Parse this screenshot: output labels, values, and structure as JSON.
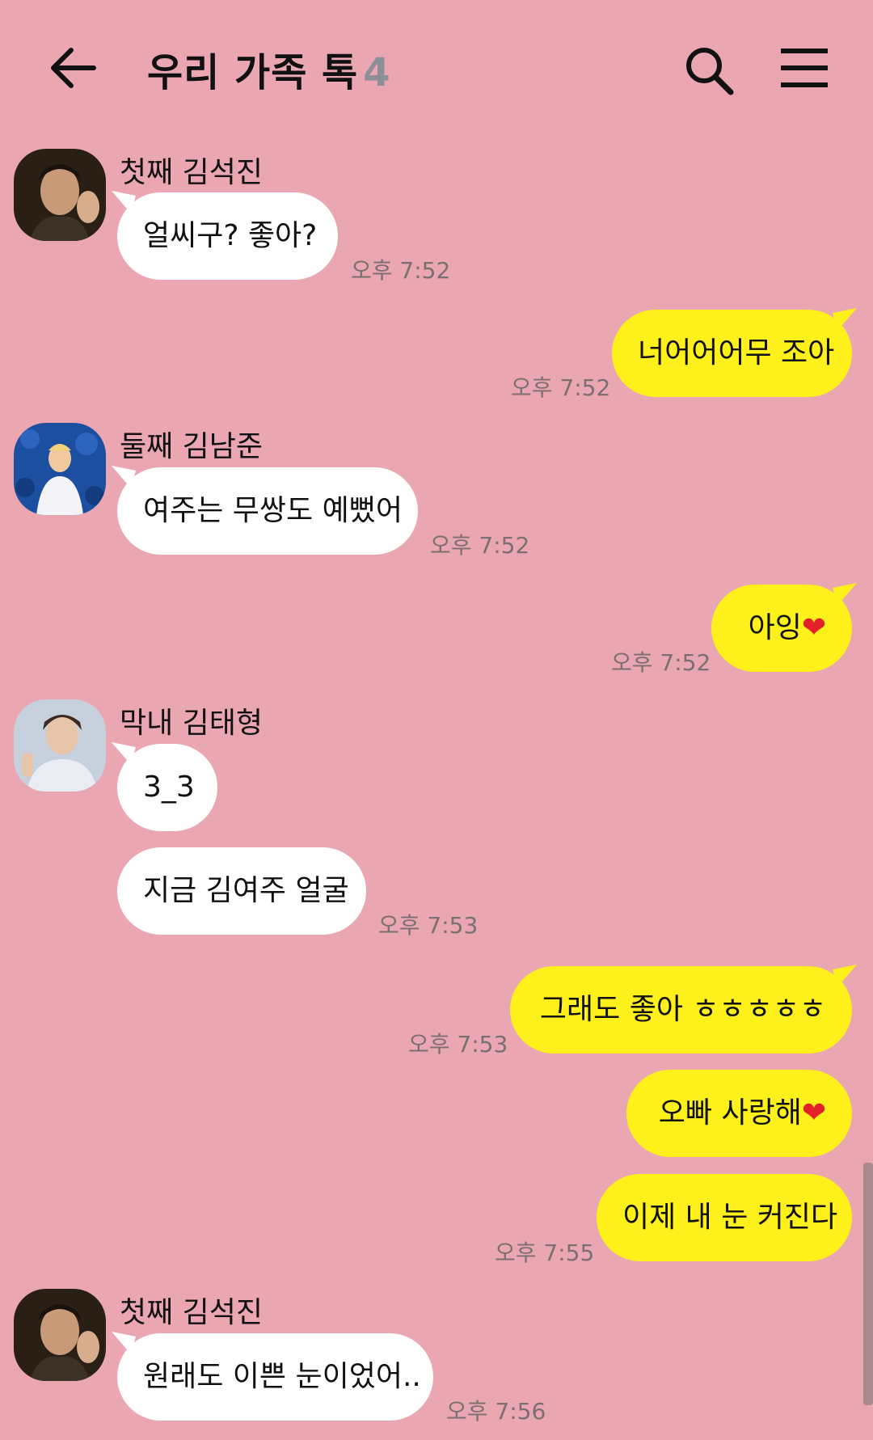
{
  "header": {
    "title": "우리 가족 톡",
    "member_count": "4",
    "icons": [
      "back-arrow-icon",
      "search-icon",
      "menu-icon"
    ]
  },
  "colors": {
    "background": "#eba7b1",
    "incoming_bubble": "#ffffff",
    "outgoing_bubble": "#fef01b",
    "heart": "#e4202a"
  },
  "messages": {
    "m1": {
      "sender": "첫째 김석진",
      "text": "얼씨구? 좋아?",
      "time": "오후 7:52"
    },
    "m2": {
      "text": "너어어어무 조아",
      "time": "오후 7:52"
    },
    "m3": {
      "sender": "둘째 김남준",
      "text": "여주는 무쌍도 예뻤어",
      "time": "오후 7:52"
    },
    "m4": {
      "text": "아잉",
      "emoji": "❤",
      "time": "오후 7:52"
    },
    "m5": {
      "sender": "막내 김태형",
      "text": "3_3"
    },
    "m6": {
      "text": "지금 김여주 얼굴",
      "time": "오후 7:53"
    },
    "m7": {
      "text": "그래도 좋아 ㅎㅎㅎㅎㅎ",
      "time": "오후 7:53"
    },
    "m8": {
      "text": "오빠 사랑해",
      "emoji": "❤"
    },
    "m9": {
      "text": "이제 내 눈 커진다",
      "time": "오후 7:55"
    },
    "m10": {
      "sender": "첫째 김석진",
      "text": "원래도 이쁜 눈이었어..",
      "time": "오후 7:56"
    }
  }
}
